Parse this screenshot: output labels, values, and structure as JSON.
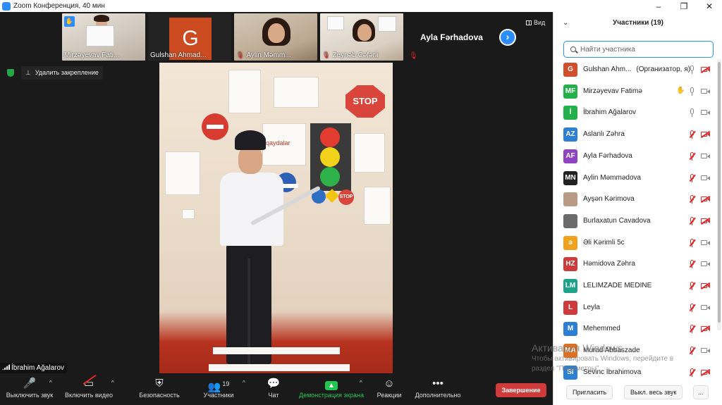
{
  "window": {
    "title": "Zoom Конференция, 40 мин",
    "minimize": "–",
    "maximize": "❐",
    "close": "✕"
  },
  "filmstrip": {
    "tiles": [
      {
        "name": "Mirzəyevav Fati...",
        "kind": "video",
        "hand": "✋",
        "muted": false
      },
      {
        "name": "Gulshan Ahmad...",
        "kind": "avatar",
        "initial": "G",
        "muted": false
      },
      {
        "name": "Aylin Məmm...",
        "kind": "video",
        "muted": true
      },
      {
        "name": "Zeynəb Cəfərli",
        "kind": "video",
        "muted": true
      }
    ],
    "active_speaker": "Ayla Fərhadova",
    "next_label": "›",
    "view_label": "Вид"
  },
  "stage": {
    "unpin_label": "Удалить закрепление",
    "pin_icon": "📌",
    "main_video_name": "İbrahim Ağalarov",
    "stop_text": "STOP",
    "stop_text_small": "STOP",
    "board_word": "qaydalar"
  },
  "toolbar": {
    "mic": {
      "label": "Выключить звук",
      "icon": "mic-icon"
    },
    "video": {
      "label": "Включить видео",
      "icon": "video-off-icon"
    },
    "security": {
      "label": "Безопасность",
      "icon": "shield-icon"
    },
    "participants": {
      "label": "Участники",
      "count": "19",
      "icon": "people-icon"
    },
    "chat": {
      "label": "Чат",
      "icon": "chat-icon"
    },
    "share": {
      "label": "Демонстрация экрана",
      "icon": "share-screen-icon"
    },
    "reactions": {
      "label": "Реакции",
      "icon": "smile-icon"
    },
    "more": {
      "label": "Дополнительно",
      "icon": "more-icon"
    },
    "end": {
      "label": "Завершение"
    },
    "caret": "^"
  },
  "panel": {
    "title": "Участники (19)",
    "search_placeholder": "Найти участника",
    "invite_label": "Пригласить",
    "mute_all_label": "Выкл. весь звук",
    "more_label": "...",
    "participants": [
      {
        "initials": "G",
        "name": "Gulshan Ahm...",
        "role": "(Организатор, я)",
        "color": "#d14f2b",
        "mic": "on",
        "cam": "off",
        "hand": false
      },
      {
        "initials": "MF",
        "name": "Mirzəyevav Fatimə",
        "role": "",
        "color": "#23b04b",
        "mic": "on",
        "cam": "on",
        "hand": true
      },
      {
        "initials": "İ",
        "name": "İbrahim Ağalarov",
        "role": "",
        "color": "#23b04b",
        "mic": "on",
        "cam": "on",
        "hand": false
      },
      {
        "initials": "AZ",
        "name": "Aslanlı Zəhra",
        "role": "",
        "color": "#2d7fd3",
        "mic": "off",
        "cam": "off",
        "hand": false
      },
      {
        "initials": "AF",
        "name": "Ayla Fərhadova",
        "role": "",
        "color": "#8e44c2",
        "mic": "off",
        "cam": "on",
        "hand": false
      },
      {
        "initials": "MN",
        "name": "Aylin Məmmədova",
        "role": "",
        "color": "#222222",
        "mic": "off",
        "cam": "on",
        "hand": false
      },
      {
        "initials": "",
        "name": "Ayşən Kərimova",
        "role": "",
        "color": "#b99a84",
        "mic": "off",
        "cam": "off",
        "hand": false
      },
      {
        "initials": "",
        "name": "Burlaxatun Cavadova",
        "role": "",
        "color": "#6b6b6b",
        "mic": "off",
        "cam": "off",
        "hand": false
      },
      {
        "initials": "ə",
        "name": "Əli Kərimli 5c",
        "role": "",
        "color": "#f0a21e",
        "mic": "off",
        "cam": "on",
        "hand": false
      },
      {
        "initials": "HZ",
        "name": "Həmidova Zəhra",
        "role": "",
        "color": "#cf3a3a",
        "mic": "off",
        "cam": "on",
        "hand": false
      },
      {
        "initials": "LM",
        "name": "LELIMZADE   MEDINE",
        "role": "",
        "color": "#1fa18a",
        "mic": "off",
        "cam": "off",
        "hand": false
      },
      {
        "initials": "L",
        "name": "Leyla",
        "role": "",
        "color": "#cf3a3a",
        "mic": "off",
        "cam": "on",
        "hand": false
      },
      {
        "initials": "M",
        "name": "Mehemmed",
        "role": "",
        "color": "#2d7fd3",
        "mic": "off",
        "cam": "off",
        "hand": false
      },
      {
        "initials": "MA",
        "name": "Murad Abbaszade",
        "role": "",
        "color": "#e07020",
        "mic": "off",
        "cam": "on",
        "hand": false
      },
      {
        "initials": "SI",
        "name": "Sevinc İbrahimova",
        "role": "",
        "color": "#2d7fd3",
        "mic": "off",
        "cam": "off",
        "hand": false
      }
    ]
  },
  "watermark": {
    "line1": "Активация Windows",
    "line2": "Чтобы активировать Windows, перейдите в раздел \"Параметры\"."
  }
}
